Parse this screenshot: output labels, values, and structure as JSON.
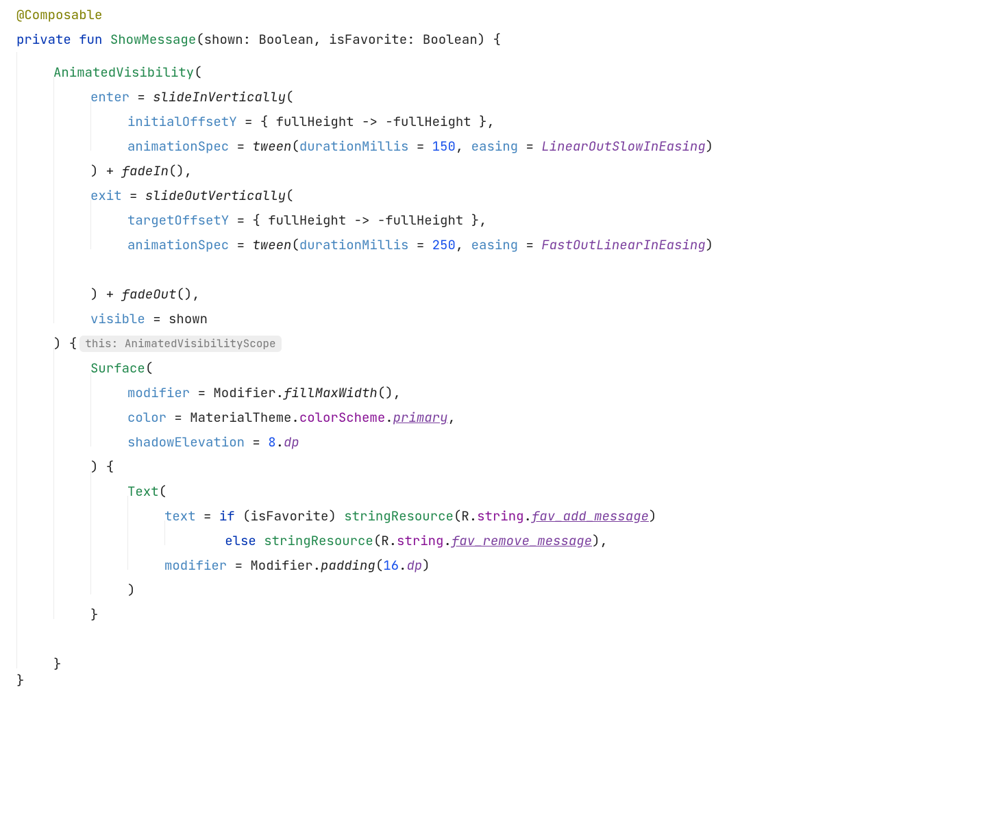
{
  "hint": {
    "lambda": "this: AnimatedVisibilityScope"
  },
  "t": {
    "annotation": "@Composable",
    "private": "private",
    "fun": "fun",
    "ShowMessage": "ShowMessage",
    "open_sig": "(",
    "shown": "shown",
    "colon": ": ",
    "Boolean": "Boolean",
    "comma_sp": ", ",
    "isFavorite": "isFavorite",
    "close_sig": ") {",
    "AnimatedVisibility": "AnimatedVisibility",
    "openp": "(",
    "enter": "enter",
    "eq": " = ",
    "slideInVertically": "slideInVertically",
    "slideOutVertically": "slideOutVertically",
    "initialOffsetY": "initialOffsetY",
    "targetOffsetY": "targetOffsetY",
    "lambda_open": "{ ",
    "fullHeight": "fullHeight",
    "arrow": " -> ",
    "neg_fullHeight": "-fullHeight",
    "lambda_close": " }",
    "comma": ",",
    "animationSpec": "animationSpec",
    "tween": "tween",
    "durationMillis": "durationMillis",
    "n150": "150",
    "n250": "250",
    "easing": "easing",
    "LinearOutSlowInEasing": "LinearOutSlowInEasing",
    "FastOutLinearInEasing": "FastOutLinearInEasing",
    "rp": ")",
    "plus_fadeIn_pre": ") + ",
    "fadeIn": "fadeIn",
    "fadeOut": "fadeOut",
    "empty_args_c": "(),",
    "exit": "exit",
    "visible": "visible",
    "shown_var": "shown",
    "close_paren_sp": ") ",
    "open_brace": "{",
    "Surface": "Surface",
    "modifier": "modifier",
    "Modifier": "Modifier",
    "dot": ".",
    "fillMaxWidth": "fillMaxWidth",
    "empty_args": "()",
    "color": "color",
    "MaterialTheme": "MaterialTheme",
    "colorScheme": "colorScheme",
    "primary": "primary",
    "shadowElevation": "shadowElevation",
    "n8": "8",
    "dp": "dp",
    "close_paren_brace": ") {",
    "Text": "Text",
    "text": "text",
    "if": "if",
    "sp_openp": " (",
    "isFavorite_var": "isFavorite",
    "closep_sp": ") ",
    "stringResource": "stringResource",
    "R": "R",
    "string": "string",
    "fav_add_message": "fav_add_message",
    "fav_remove_message": "fav_remove_message",
    "else": "else",
    "sp": " ",
    "padding": "padding",
    "n16": "16",
    "close_brace": "}"
  }
}
